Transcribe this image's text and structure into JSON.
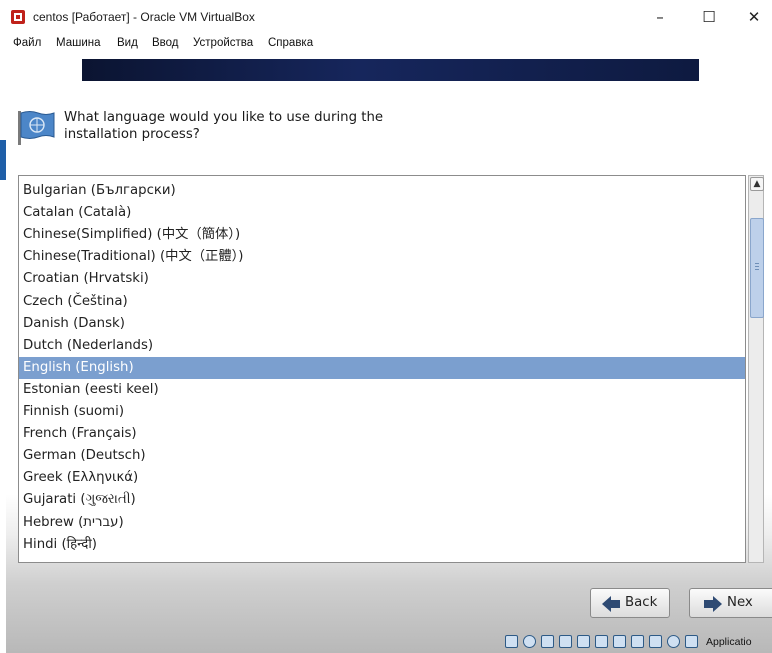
{
  "window": {
    "title": "centos [Работает] - Oracle VM VirtualBox",
    "minimize_glyph": "–",
    "maximize_glyph": "☐",
    "close_glyph": "✕"
  },
  "menu": [
    "Файл",
    "Машина",
    "Вид",
    "Ввод",
    "Устройства",
    "Справка"
  ],
  "installer": {
    "question": "What language would you like to use during the installation process?",
    "languages": [
      "Bulgarian (Български)",
      "Catalan (Català)",
      "Chinese(Simplified) (中文（簡体）)",
      "Chinese(Traditional) (中文（正體）)",
      "Croatian (Hrvatski)",
      "Czech (Čeština)",
      "Danish (Dansk)",
      "Dutch (Nederlands)",
      "English (English)",
      "Estonian (eesti keel)",
      "Finnish (suomi)",
      "French (Français)",
      "German (Deutsch)",
      "Greek (Ελληνικά)",
      "Gujarati (ગુજરાતી)",
      "Hebrew (עברית)",
      "Hindi (हिन्दी)"
    ],
    "selected_language": "English (English)",
    "back_label": "Back",
    "next_label": "Nex"
  },
  "statusbar": {
    "text": "Applicatio"
  },
  "colors": {
    "selection": "#7b9fcf",
    "banner": "#16265c"
  }
}
